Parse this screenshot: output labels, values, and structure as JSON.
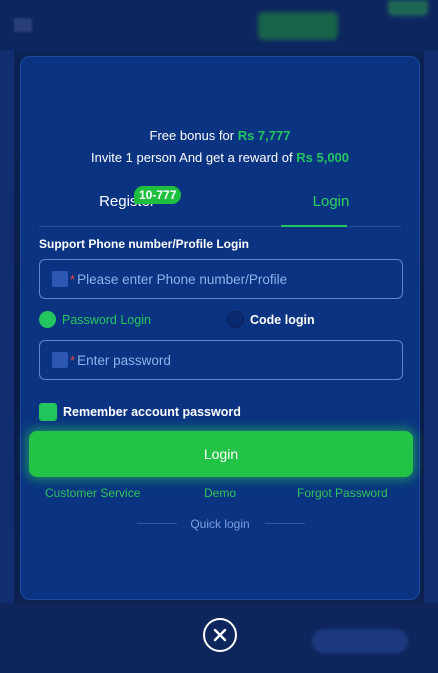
{
  "bonus": {
    "line1_prefix": "Free bonus for",
    "line1_amount": "Rs 7,777",
    "line2_prefix": "Invite 1 person And get a reward of",
    "line2_amount": "Rs 5,000"
  },
  "tabs": {
    "register_label": "Register",
    "register_badge": "10-777",
    "login_label": "Login"
  },
  "form": {
    "section_label": "Support Phone number/Profile Login",
    "phone_placeholder": "Please enter Phone number/Profile",
    "password_login_label": "Password Login",
    "code_login_label": "Code login",
    "password_placeholder": "Enter password",
    "required_mark": "*",
    "remember_label": "Remember account password",
    "login_button": "Login"
  },
  "links": {
    "customer_service": "Customer Service",
    "demo": "Demo",
    "forgot_password": "Forgot Password"
  },
  "quick_login": "Quick login",
  "colors": {
    "accent_green": "#22c55e",
    "modal_bg": "#0a3482",
    "required_red": "#ef4444"
  },
  "icons": {
    "close": "close-circle-icon"
  }
}
